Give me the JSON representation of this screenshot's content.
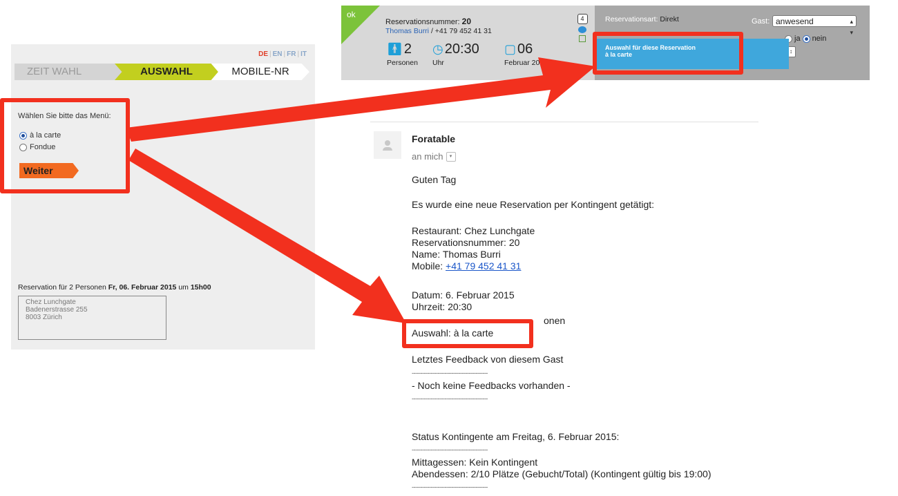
{
  "widget": {
    "lang": {
      "active": "DE",
      "others": [
        "EN",
        "FR",
        "IT"
      ],
      "sep": "|"
    },
    "steps": [
      "ZEIT WAHL",
      "AUSWAHL",
      "MOBILE-NR"
    ],
    "menu_prompt": "Wählen Sie bitte das Menü:",
    "options": [
      {
        "label": "à la carte",
        "selected": true
      },
      {
        "label": "Fondue",
        "selected": false
      }
    ],
    "next_button": "Weiter",
    "reservation": {
      "prefix": "Reservation für 2 Personen",
      "date": "Fr, 06. Februar 2015",
      "mid": "um",
      "time": "15h00"
    },
    "address": [
      "Chez Lunchgate",
      "Badenerstrasse 255",
      "8003 Zürich"
    ]
  },
  "panel": {
    "status": "ok",
    "resnum_label": "Reservationsnummer:",
    "resnum_value": "20",
    "guest_name": "Thomas Burri",
    "guest_phone": "/ +41 79 452 41 31",
    "persons_value": "2",
    "persons_label": "Personen",
    "time_value": "20:30",
    "time_label": "Uhr",
    "day_value": "06",
    "month_label": "Februar 2015",
    "badge_count": "4",
    "resart_label": "Reservationsart:",
    "resart_value": "Direkt",
    "gast_label": "Gast:",
    "gast_value": "anwesend",
    "ja_label": "ja",
    "nein_label": "nein",
    "tooltip_line1": "Auswahl für diese Reservation",
    "tooltip_line2": "à la carte"
  },
  "email": {
    "sender": "Foratable",
    "to": "an mich",
    "greeting": "Guten Tag",
    "intro": "Es wurde eine neue Reservation per Kontingent getätigt:",
    "restaurant": "Restaurant: Chez Lunchgate",
    "resnum": "Reservationsnummer: 20",
    "name": "Name: Thomas Burri",
    "mobile_label": "Mobile:",
    "mobile_value": "+41 79 452 41 31",
    "date": "Datum: 6. Februar 2015",
    "time": "Uhrzeit: 20:30",
    "persons_partial": "onen",
    "selection": "Auswahl: à la carte",
    "feedback_title": "Letztes Feedback von diesem Gast",
    "no_feedback": "- Noch keine Feedbacks vorhanden -",
    "status_title": "Status Kontingente am Freitag, 6. Februar 2015:",
    "lunch": "Mittagessen: Kein Kontingent",
    "dinner": "Abendessen: 2/10 Plätze (Gebucht/Total) (Kontingent gültig bis 19:00)",
    "dash_line": "--------------------------------------------"
  },
  "colors": {
    "highlight": "#f2301e",
    "step_active": "#c2cf1f",
    "next_button": "#f26a21",
    "ok": "#7cc33a",
    "tooltip": "#3fa7dc",
    "link": "#1a56c9"
  }
}
